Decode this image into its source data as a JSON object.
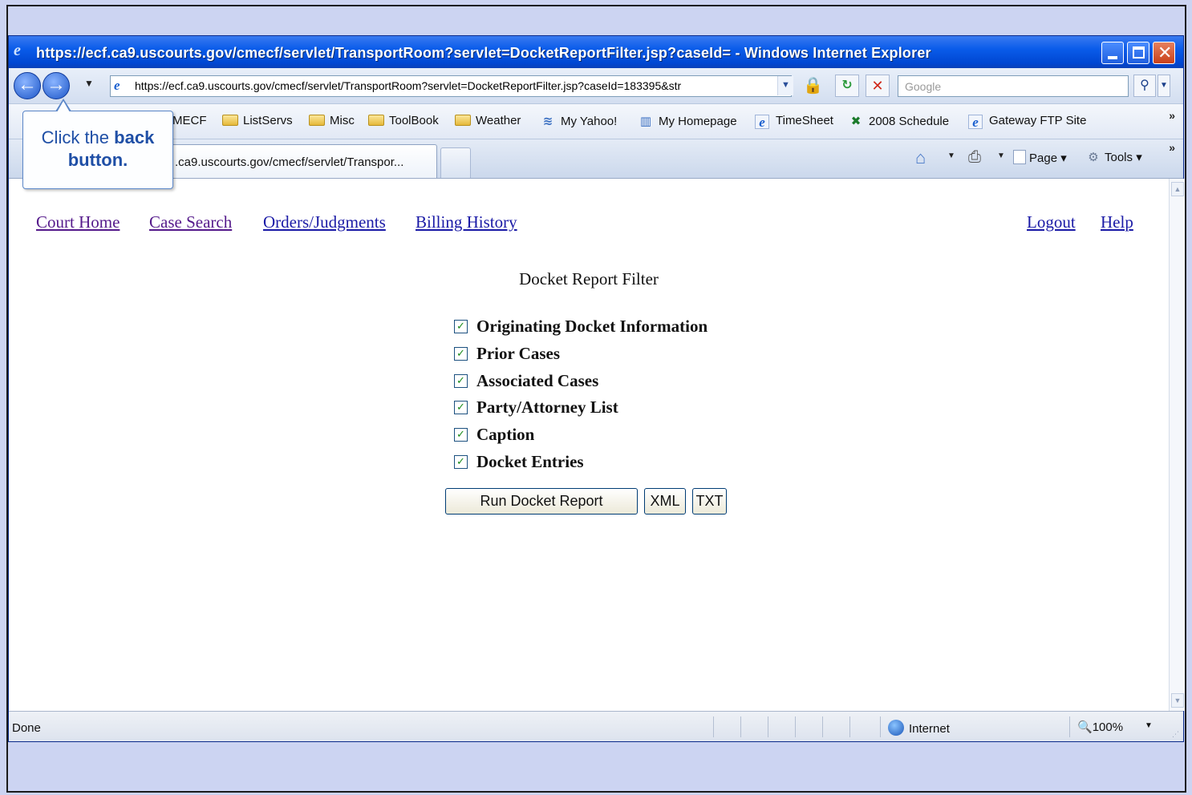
{
  "window": {
    "title": "https://ecf.ca9.uscourts.gov/cmecf/servlet/TransportRoom?servlet=DocketReportFilter.jsp?caseId= - Windows Internet Explorer"
  },
  "address_bar": {
    "url": "https://ecf.ca9.uscourts.gov/cmecf/servlet/TransportRoom?servlet=DocketReportFilter.jsp?caseId=183395&str",
    "search_placeholder": "Google"
  },
  "favorites": [
    "MECF",
    "ListServs",
    "Misc",
    "ToolBook",
    "Weather",
    "My Yahoo!",
    "My Homepage",
    "TimeSheet",
    "2008 Schedule",
    "Gateway FTP Site"
  ],
  "tab": {
    "label": ".ca9.uscourts.gov/cmecf/servlet/Transpor..."
  },
  "command_bar": {
    "page_label": "Page",
    "tools_label": "Tools"
  },
  "callout": {
    "prefix": "Click the ",
    "emphasis": "back",
    "line2": "button."
  },
  "page": {
    "nav_left": [
      "Court Home",
      "Case Search",
      "Orders/Judgments",
      "Billing History"
    ],
    "nav_right": [
      "Logout",
      "Help"
    ],
    "title": "Docket Report Filter",
    "options": [
      {
        "label": "Originating Docket Information",
        "checked": true
      },
      {
        "label": "Prior Cases",
        "checked": true
      },
      {
        "label": "Associated Cases",
        "checked": true
      },
      {
        "label": "Party/Attorney List",
        "checked": true
      },
      {
        "label": "Caption",
        "checked": true
      },
      {
        "label": "Docket Entries",
        "checked": true
      }
    ],
    "buttons": {
      "run": "Run Docket Report",
      "xml": "XML",
      "txt": "TXT"
    }
  },
  "status_bar": {
    "status": "Done",
    "zone": "Internet",
    "zoom": "100%"
  },
  "colors": {
    "visited_link": "#551a8b",
    "link": "#1a1aa6",
    "titlebar": "#0a5cea"
  }
}
